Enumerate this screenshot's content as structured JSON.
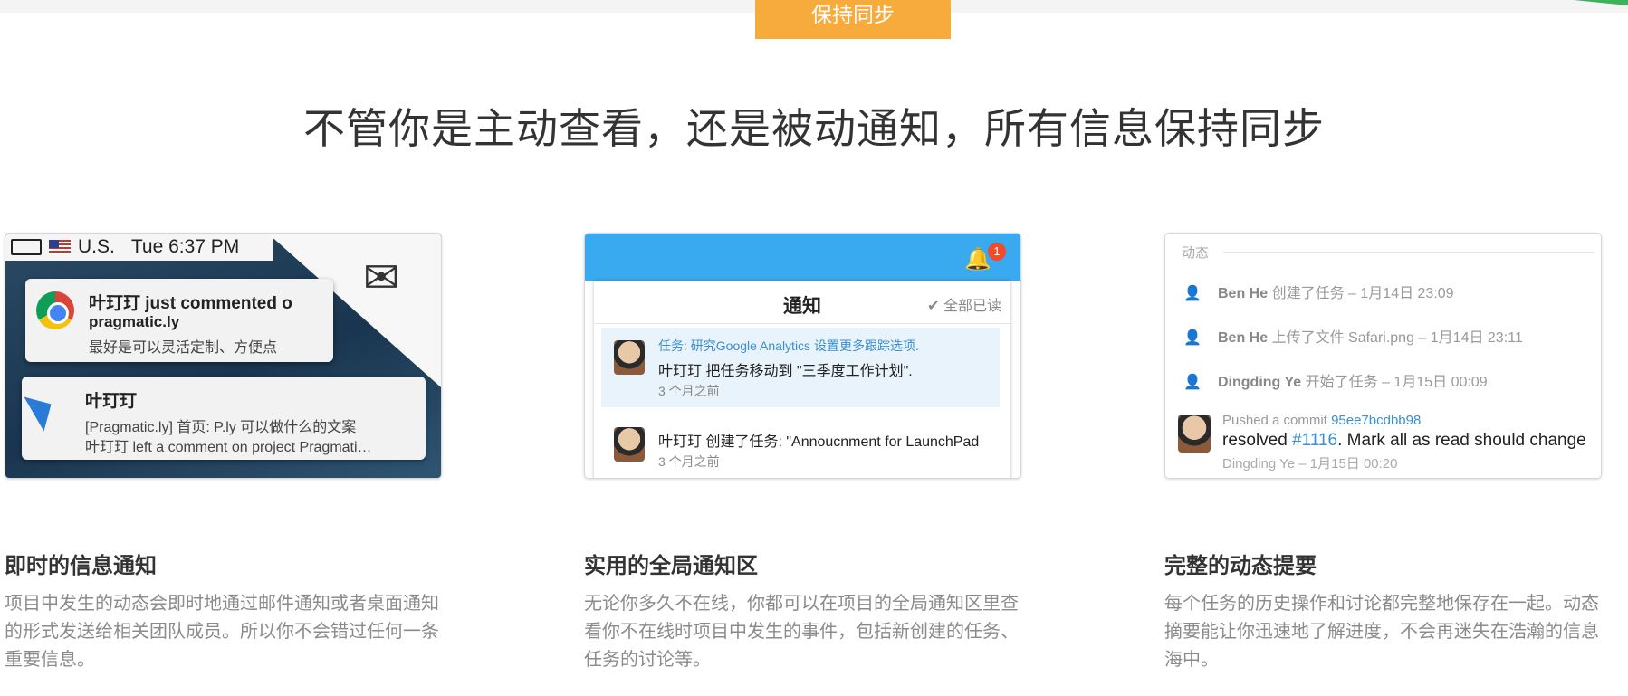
{
  "tab": {
    "label": "保持同步"
  },
  "headline": "不管你是主动查看，还是被动通知，所有信息保持同步",
  "card1": {
    "menubar": {
      "region": "U.S.",
      "time": "Tue 6:37 PM"
    },
    "notif1": {
      "title": "叶玎玎 just commented o",
      "source": "pragmatic.ly",
      "body": "最好是可以灵活定制、方便点"
    },
    "notif2": {
      "title": "叶玎玎",
      "line1": "[Pragmatic.ly] 首页: P.ly 可以做什么的文案",
      "line2": "叶玎玎 left a comment on project Pragmati…"
    }
  },
  "card2": {
    "badge": "1",
    "panel_title": "通知",
    "mark_all": "全部已读",
    "items": [
      {
        "link": "任务: 研究Google Analytics 设置更多跟踪选项.",
        "text": "叶玎玎 把任务移动到 \"三季度工作计划\".",
        "time": "3 个月之前"
      },
      {
        "text": "叶玎玎 创建了任务: \"Annoucnment for LaunchPad",
        "time": "3 个月之前"
      }
    ]
  },
  "card3": {
    "label": "动态",
    "activities": [
      {
        "user": "Ben He",
        "action": "创建了任务",
        "time": "– 1月14日 23:09"
      },
      {
        "user": "Ben He",
        "action": "上传了文件 Safari.png",
        "time": "– 1月14日 23:11"
      },
      {
        "user": "Dingding Ye",
        "action": "开始了任务",
        "time": "– 1月15日 00:09"
      }
    ],
    "commit": {
      "prefix": "Pushed a commit",
      "hash": "95ee7bcdbb98",
      "main_prefix": "resolved",
      "issue": "#1116",
      "main_rest": ". Mark all as read should change",
      "foot": "Dingding Ye – 1月15日 00:20"
    }
  },
  "features": [
    {
      "title": "即时的信息通知",
      "desc": "项目中发生的动态会即时地通过邮件通知或者桌面通知的形式发送给相关团队成员。所以你不会错过任何一条重要信息。"
    },
    {
      "title": "实用的全局通知区",
      "desc": "无论你多久不在线，你都可以在项目的全局通知区里查看你不在线时项目中发生的事件，包括新创建的任务、任务的讨论等。"
    },
    {
      "title": "完整的动态提要",
      "desc": "每个任务的历史操作和讨论都完整地保存在一起。动态摘要能让你迅速地了解进度，不会再迷失在浩瀚的信息海中。"
    }
  ]
}
